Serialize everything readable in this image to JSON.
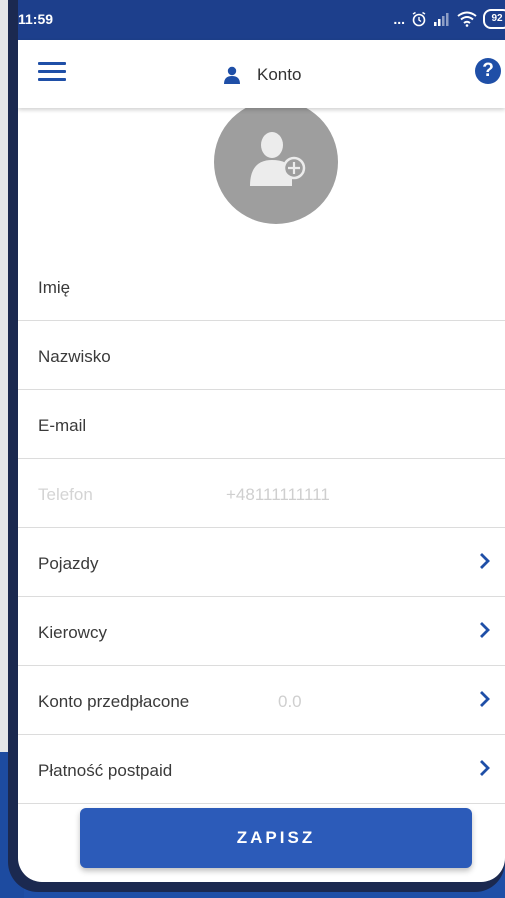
{
  "status_bar": {
    "time": "11:59",
    "more": "...",
    "battery": "92"
  },
  "header": {
    "title": "Konto",
    "help_label": "?"
  },
  "form": {
    "first_name": {
      "label": "Imię"
    },
    "last_name": {
      "label": "Nazwisko"
    },
    "email": {
      "label": "E-mail"
    },
    "phone": {
      "label": "Telefon",
      "value": "+48111111111"
    },
    "vehicles": {
      "label": "Pojazdy"
    },
    "drivers": {
      "label": "Kierowcy"
    },
    "prepaid": {
      "label": "Konto przedpłacone",
      "value": "0.0"
    },
    "postpaid": {
      "label": "Płatność postpaid"
    }
  },
  "actions": {
    "save_label": "ZAPISZ"
  },
  "colors": {
    "primary": "#1f4fa7",
    "status_bar": "#1d3f8c",
    "avatar_bg": "#9e9e9e",
    "button": "#2c5bb9"
  }
}
